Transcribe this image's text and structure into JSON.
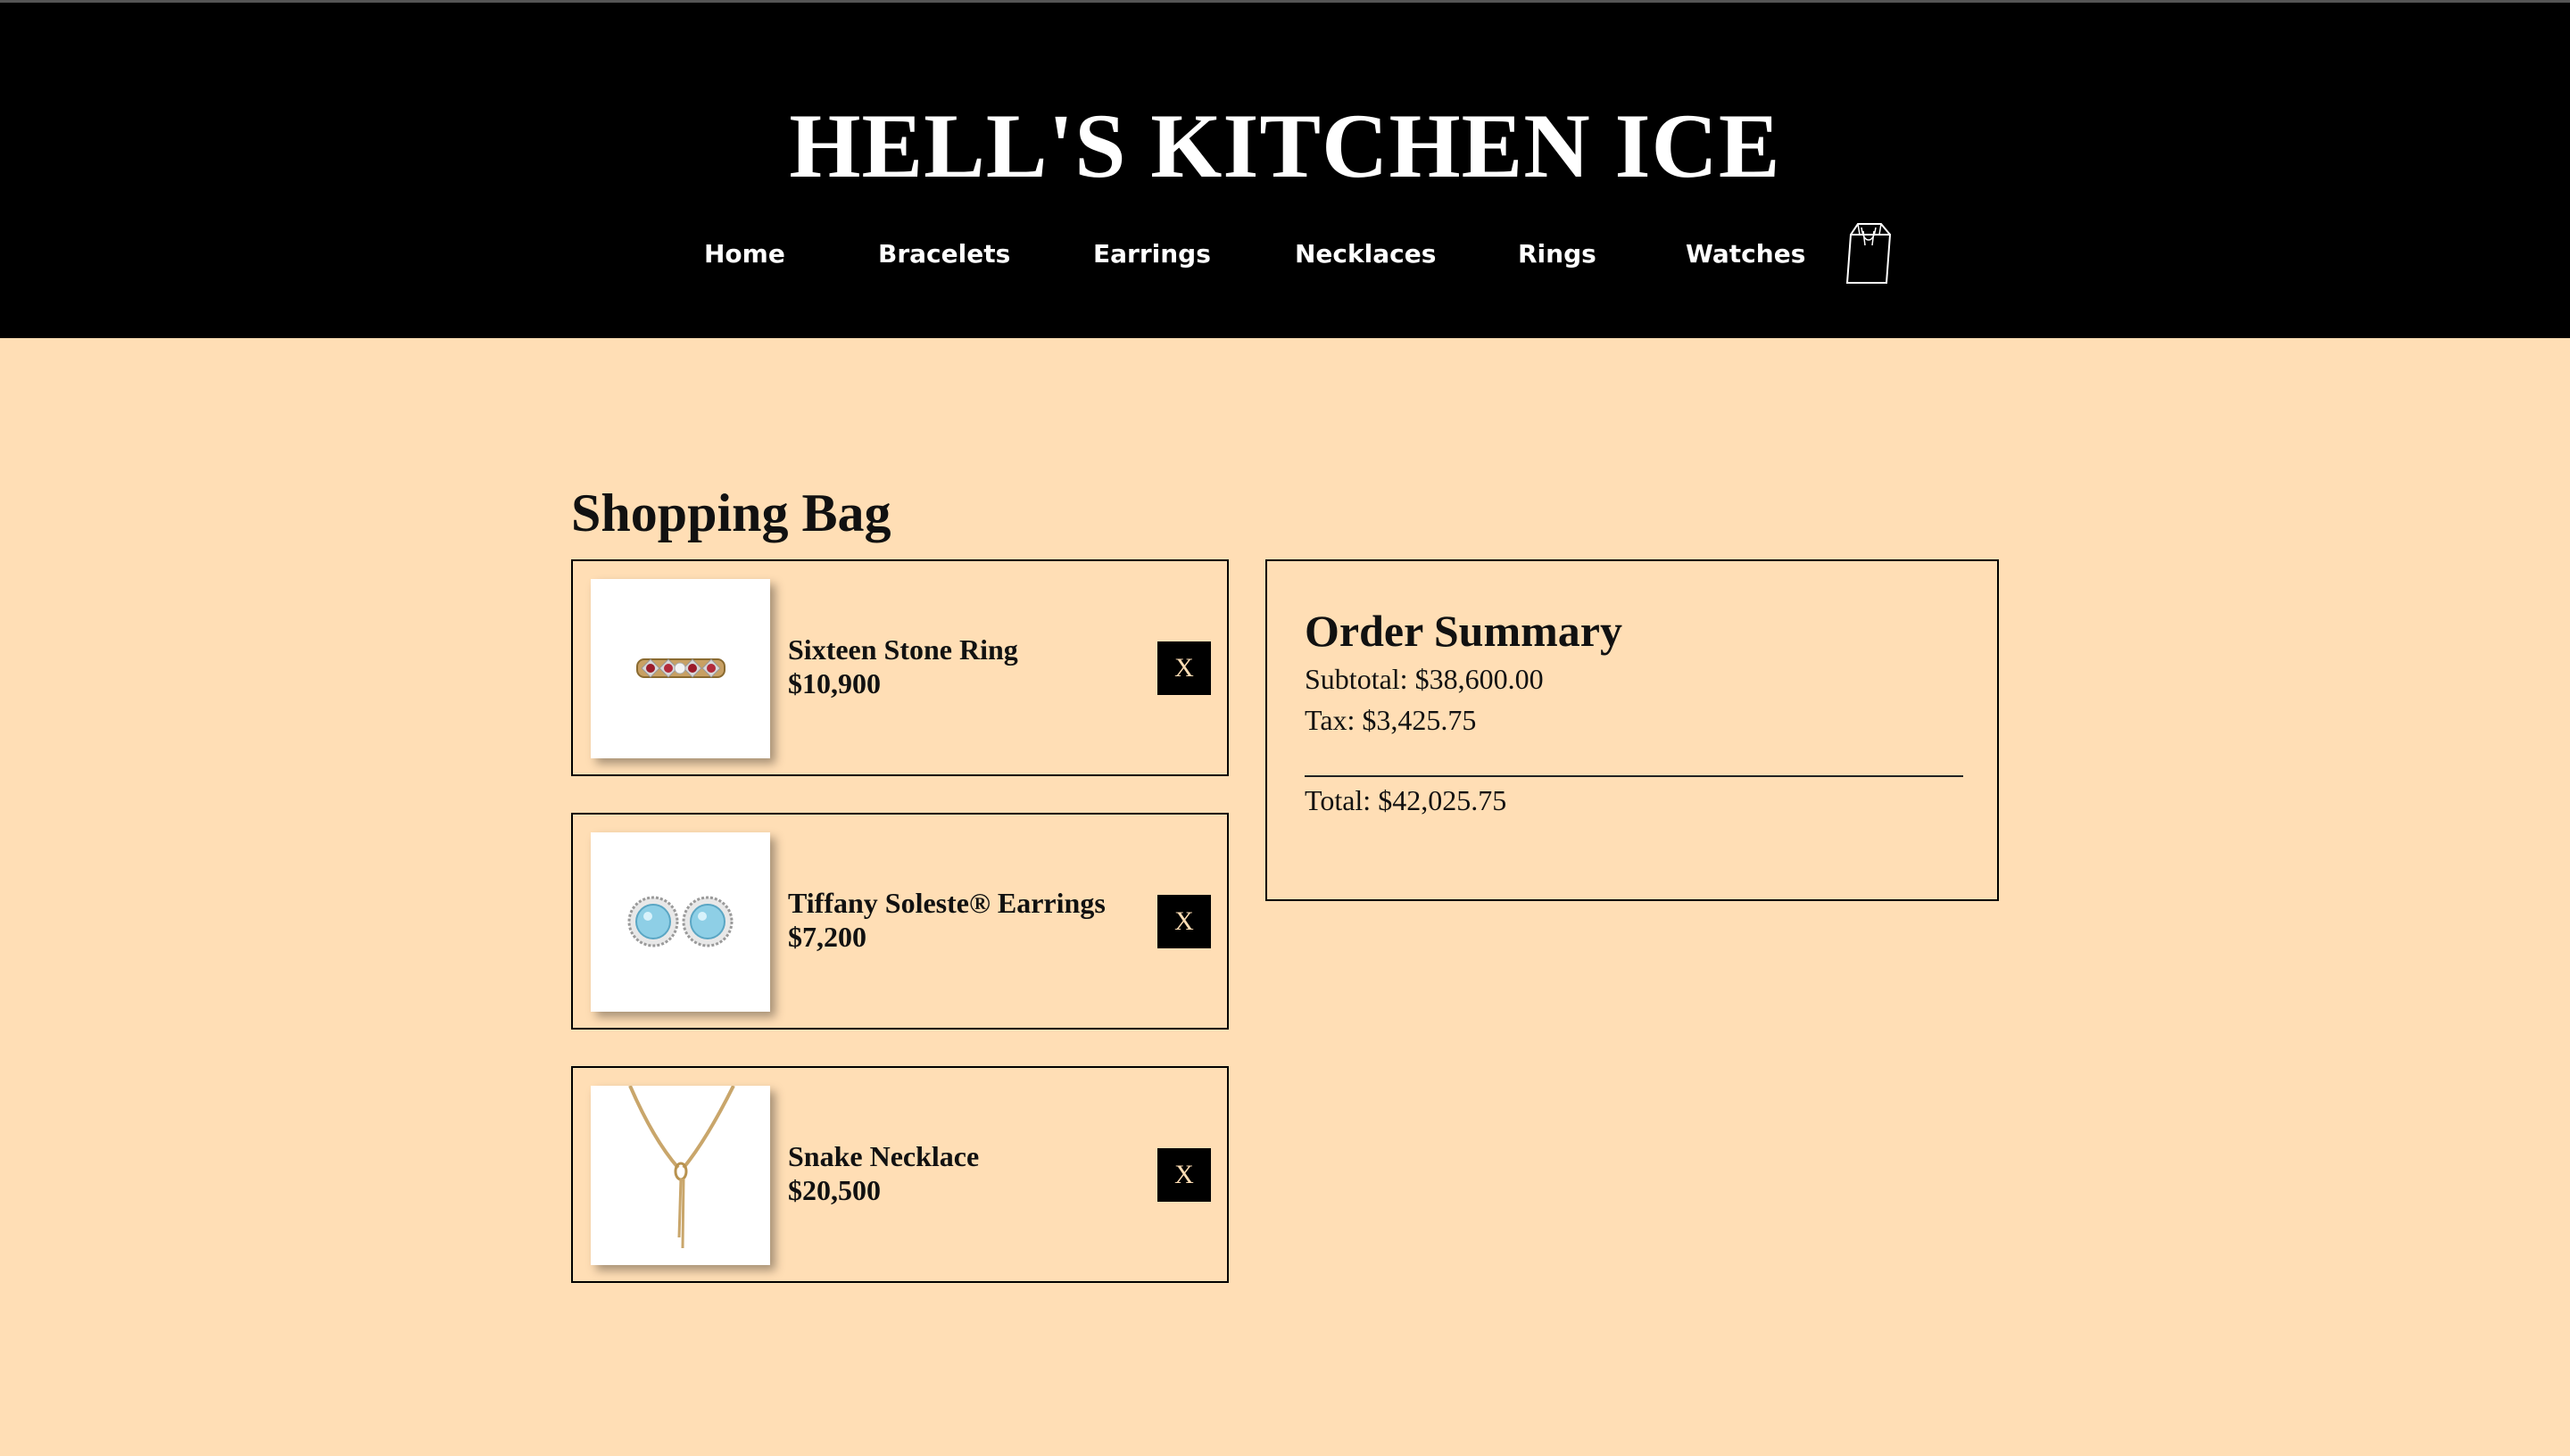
{
  "site": {
    "title": "HELL'S KITCHEN ICE",
    "nav": [
      "Home",
      "Bracelets",
      "Earrings",
      "Necklaces",
      "Rings",
      "Watches"
    ],
    "cart_icon": "shopping-bag-icon"
  },
  "page": {
    "title": "Shopping Bag"
  },
  "cart": {
    "items": [
      {
        "name": "Sixteen Stone Ring",
        "price": "$10,900",
        "image": "ring-image",
        "remove_label": "X"
      },
      {
        "name": "Tiffany Soleste® Earrings",
        "price": "$7,200",
        "image": "earrings-image",
        "remove_label": "X"
      },
      {
        "name": "Snake Necklace",
        "price": "$20,500",
        "image": "necklace-image",
        "remove_label": "X"
      }
    ]
  },
  "summary": {
    "title": "Order Summary",
    "subtotal": "Subtotal: $38,600.00",
    "tax": "Tax: $3,425.75",
    "total": "Total: $42,025.75"
  },
  "colors": {
    "background": "#FFDEB5",
    "header": "#000000",
    "button_text": "#FFDEB5"
  }
}
